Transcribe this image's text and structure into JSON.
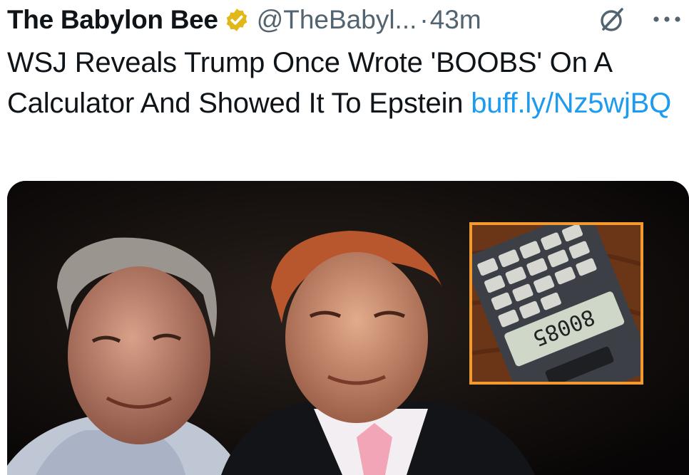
{
  "tweet": {
    "author_name": "The Babylon Bee",
    "handle": "@TheBabyl...",
    "separator": "·",
    "time": "43m",
    "text": "WSJ Reveals Trump Once Wrote 'BOOBS' On A Calculator And Showed It To Epstein ",
    "link_text": "buff.ly/​Nz5wjBQ",
    "icons": [
      "verified-badge-icon",
      "grok-icon",
      "more-icon"
    ]
  },
  "media": {
    "calculator_display": "80085"
  },
  "colors": {
    "link": "#1d9bf0",
    "secondary_text": "#536471",
    "verified_gold": "#e2b719",
    "inset_border": "#f29a2e"
  }
}
